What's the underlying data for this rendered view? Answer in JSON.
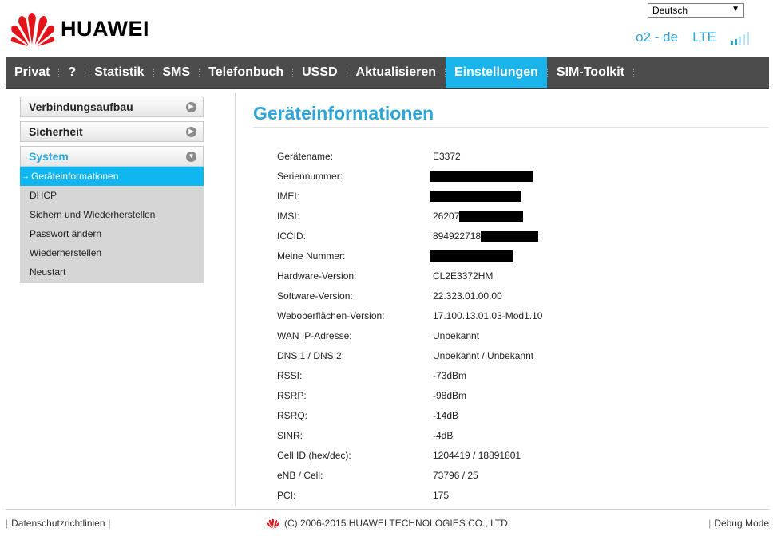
{
  "brand": {
    "name": "HUAWEI"
  },
  "language": {
    "selected": "Deutsch"
  },
  "status": {
    "operator": "o2 - de",
    "network": "LTE",
    "signal_bars_active": 2,
    "signal_bars_total": 5
  },
  "nav": {
    "items": [
      "Privat",
      "?",
      "Statistik",
      "SMS",
      "Telefonbuch",
      "USSD",
      "Aktualisieren",
      "Einstellungen",
      "SIM-Toolkit"
    ],
    "active": "Einstellungen"
  },
  "sidebar": {
    "sections": [
      "Verbindungsaufbau",
      "Sicherheit",
      "System"
    ],
    "open_section": "System",
    "sub_items": [
      "Geräteinformationen",
      "DHCP",
      "Sichern und Wiederherstellen",
      "Passwort ändern",
      "Wiederherstellen",
      "Neustart"
    ],
    "active_item": "Geräteinformationen"
  },
  "page": {
    "title": "Geräteinformationen"
  },
  "device_info": [
    {
      "label": "Gerätename:",
      "value": "E3372"
    },
    {
      "label": "Seriennummer:",
      "value": ""
    },
    {
      "label": "IMEI:",
      "value": ""
    },
    {
      "label": "IMSI:",
      "value": "26207"
    },
    {
      "label": "ICCID:",
      "value": "894922718"
    },
    {
      "label": "Meine Nummer:",
      "value": ""
    },
    {
      "label": "Hardware-Version:",
      "value": "CL2E3372HM"
    },
    {
      "label": "Software-Version:",
      "value": "22.323.01.00.00"
    },
    {
      "label": "Weboberflächen-Version:",
      "value": "17.100.13.01.03-Mod1.10"
    },
    {
      "label": "WAN IP-Adresse:",
      "value": "Unbekannt"
    },
    {
      "label": "DNS 1 / DNS 2:",
      "value": "Unbekannt / Unbekannt"
    },
    {
      "label": "RSSI:",
      "value": "-73dBm"
    },
    {
      "label": "RSRP:",
      "value": "-98dBm"
    },
    {
      "label": "RSRQ:",
      "value": "-14dB"
    },
    {
      "label": "SINR:",
      "value": "-4dB"
    },
    {
      "label": "Cell ID (hex/dec):",
      "value": "1204419 / 18891801"
    },
    {
      "label": "eNB / Cell:",
      "value": "73796 / 25"
    },
    {
      "label": "PCI:",
      "value": "175"
    }
  ],
  "footer": {
    "privacy": "Datenschutzrichtlinien",
    "copyright": "(C) 2006-2015 HUAWEI TECHNOLOGIES CO., LTD.",
    "debug": "Debug Mode"
  }
}
